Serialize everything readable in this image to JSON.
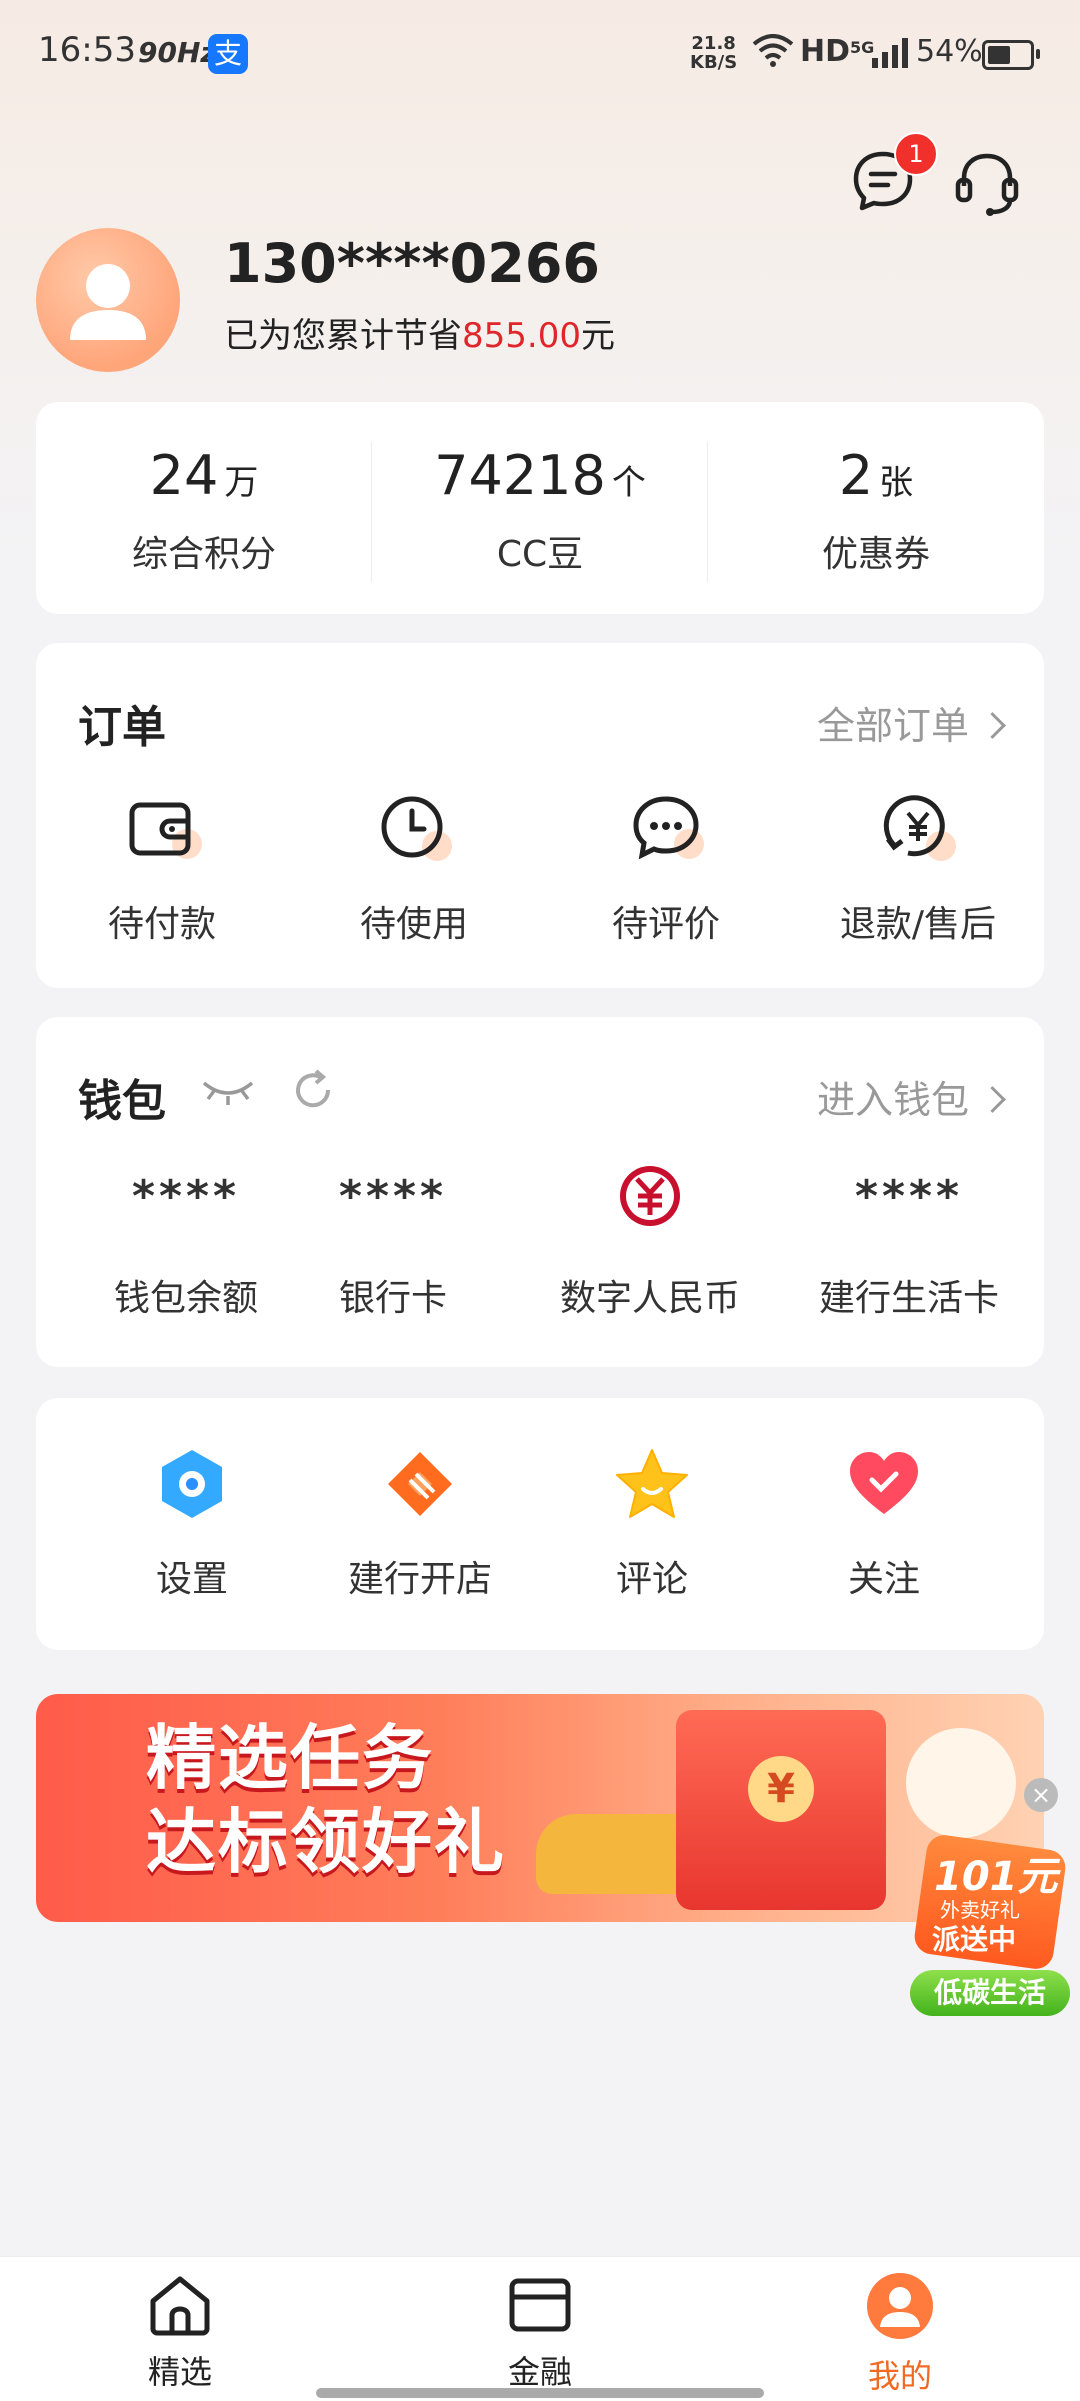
{
  "status_bar": {
    "time": "16:53",
    "refresh_rate": "90Hz",
    "alipay_icon": "支",
    "net_speed": "21.8",
    "net_speed_unit": "KB/S",
    "hd": "HD",
    "network": "5G",
    "battery": "54%"
  },
  "header": {
    "message_badge": "1"
  },
  "profile": {
    "phone": "130****0266",
    "saving_prefix": "已为您累计节省",
    "saving_amount": "855.00",
    "saving_suffix": "元"
  },
  "stats": [
    {
      "value": "24",
      "unit": "万",
      "label": "综合积分"
    },
    {
      "value": "74218",
      "unit": "个",
      "label": "CC豆"
    },
    {
      "value": "2",
      "unit": "张",
      "label": "优惠券"
    }
  ],
  "orders": {
    "title": "订单",
    "link": "全部订单",
    "items": [
      {
        "label": "待付款",
        "icon": "wallet-icon"
      },
      {
        "label": "待使用",
        "icon": "clock-icon"
      },
      {
        "label": "待评价",
        "icon": "chat-bubble-icon"
      },
      {
        "label": "退款/售后",
        "icon": "refund-yuan-icon"
      }
    ]
  },
  "wallet": {
    "title": "钱包",
    "link": "进入钱包",
    "items": [
      {
        "value": "****",
        "label": "钱包余额"
      },
      {
        "value": "****",
        "label": "银行卡"
      },
      {
        "value": "",
        "label": "数字人民币",
        "icon": "digital-rmb-icon"
      },
      {
        "value": "****",
        "label": "建行生活卡"
      }
    ]
  },
  "tools": [
    {
      "label": "设置",
      "icon": "settings-hexagon-icon"
    },
    {
      "label": "建行开店",
      "icon": "shop-icon"
    },
    {
      "label": "评论",
      "icon": "star-icon"
    },
    {
      "label": "关注",
      "icon": "heart-icon"
    }
  ],
  "banner": {
    "line1": "精选任务",
    "line2": "达标领好礼",
    "coin": "¥"
  },
  "promo": {
    "amount": "101元",
    "line2": "外卖好礼",
    "line3": "派送中",
    "tag": "低碳生活"
  },
  "bottom_nav": [
    {
      "label": "精选",
      "icon": "home-icon"
    },
    {
      "label": "金融",
      "icon": "card-icon"
    },
    {
      "label": "我的",
      "icon": "profile-icon",
      "active": true
    }
  ],
  "colors": {
    "accent": "#f06a24",
    "red_amount": "#e0252b",
    "badge": "#f1302c"
  }
}
